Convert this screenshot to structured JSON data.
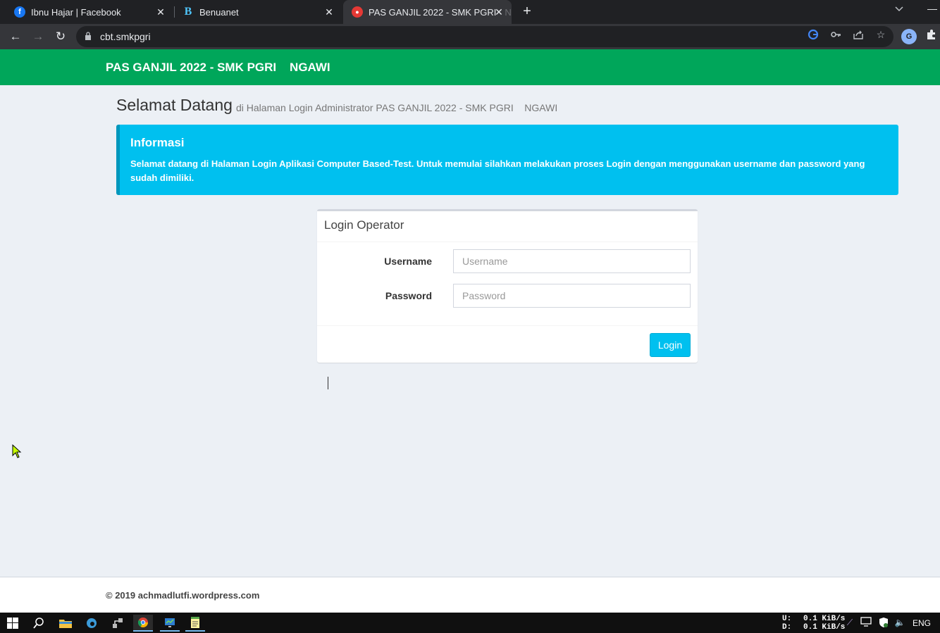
{
  "browser": {
    "tabs": [
      {
        "title": "Ibnu Hajar | Facebook",
        "favicon": "facebook-icon"
      },
      {
        "title": "Benuanet",
        "favicon": "benuanet-b-icon"
      },
      {
        "title": "PAS GANJIL 2022 - SMK PGRI",
        "title_fade": "N",
        "favicon": "cbt-app-icon",
        "active": true
      }
    ],
    "url": "cbt.smkpgri"
  },
  "header": {
    "brand": "PAS GANJIL 2022 - SMK PGRI    NGAWI",
    "color": "#00a65a"
  },
  "page": {
    "title": "Selamat Datang",
    "subtitle": "di Halaman Login Administrator PAS GANJIL 2022 - SMK PGRI    NGAWI"
  },
  "callout": {
    "title": "Informasi",
    "text": "Selamat datang di Halaman Login Aplikasi Computer Based-Test. Untuk memulai silahkan melakukan proses Login dengan menggunakan username dan password yang sudah dimiliki.",
    "color": "#00c0ef"
  },
  "login_box": {
    "title": "Login Operator",
    "username_label": "Username",
    "username_placeholder": "Username",
    "username_value": "",
    "password_label": "Password",
    "password_placeholder": "Password",
    "password_value": "",
    "submit_label": "Login"
  },
  "footer": {
    "text": "© 2019 achmadlutfi.wordpress.com"
  },
  "taskbar": {
    "upload_label": "U:",
    "upload_speed": "0.1 KiB/s",
    "download_label": "D:",
    "download_speed": "0.1 KiB/s",
    "language": "ENG"
  }
}
